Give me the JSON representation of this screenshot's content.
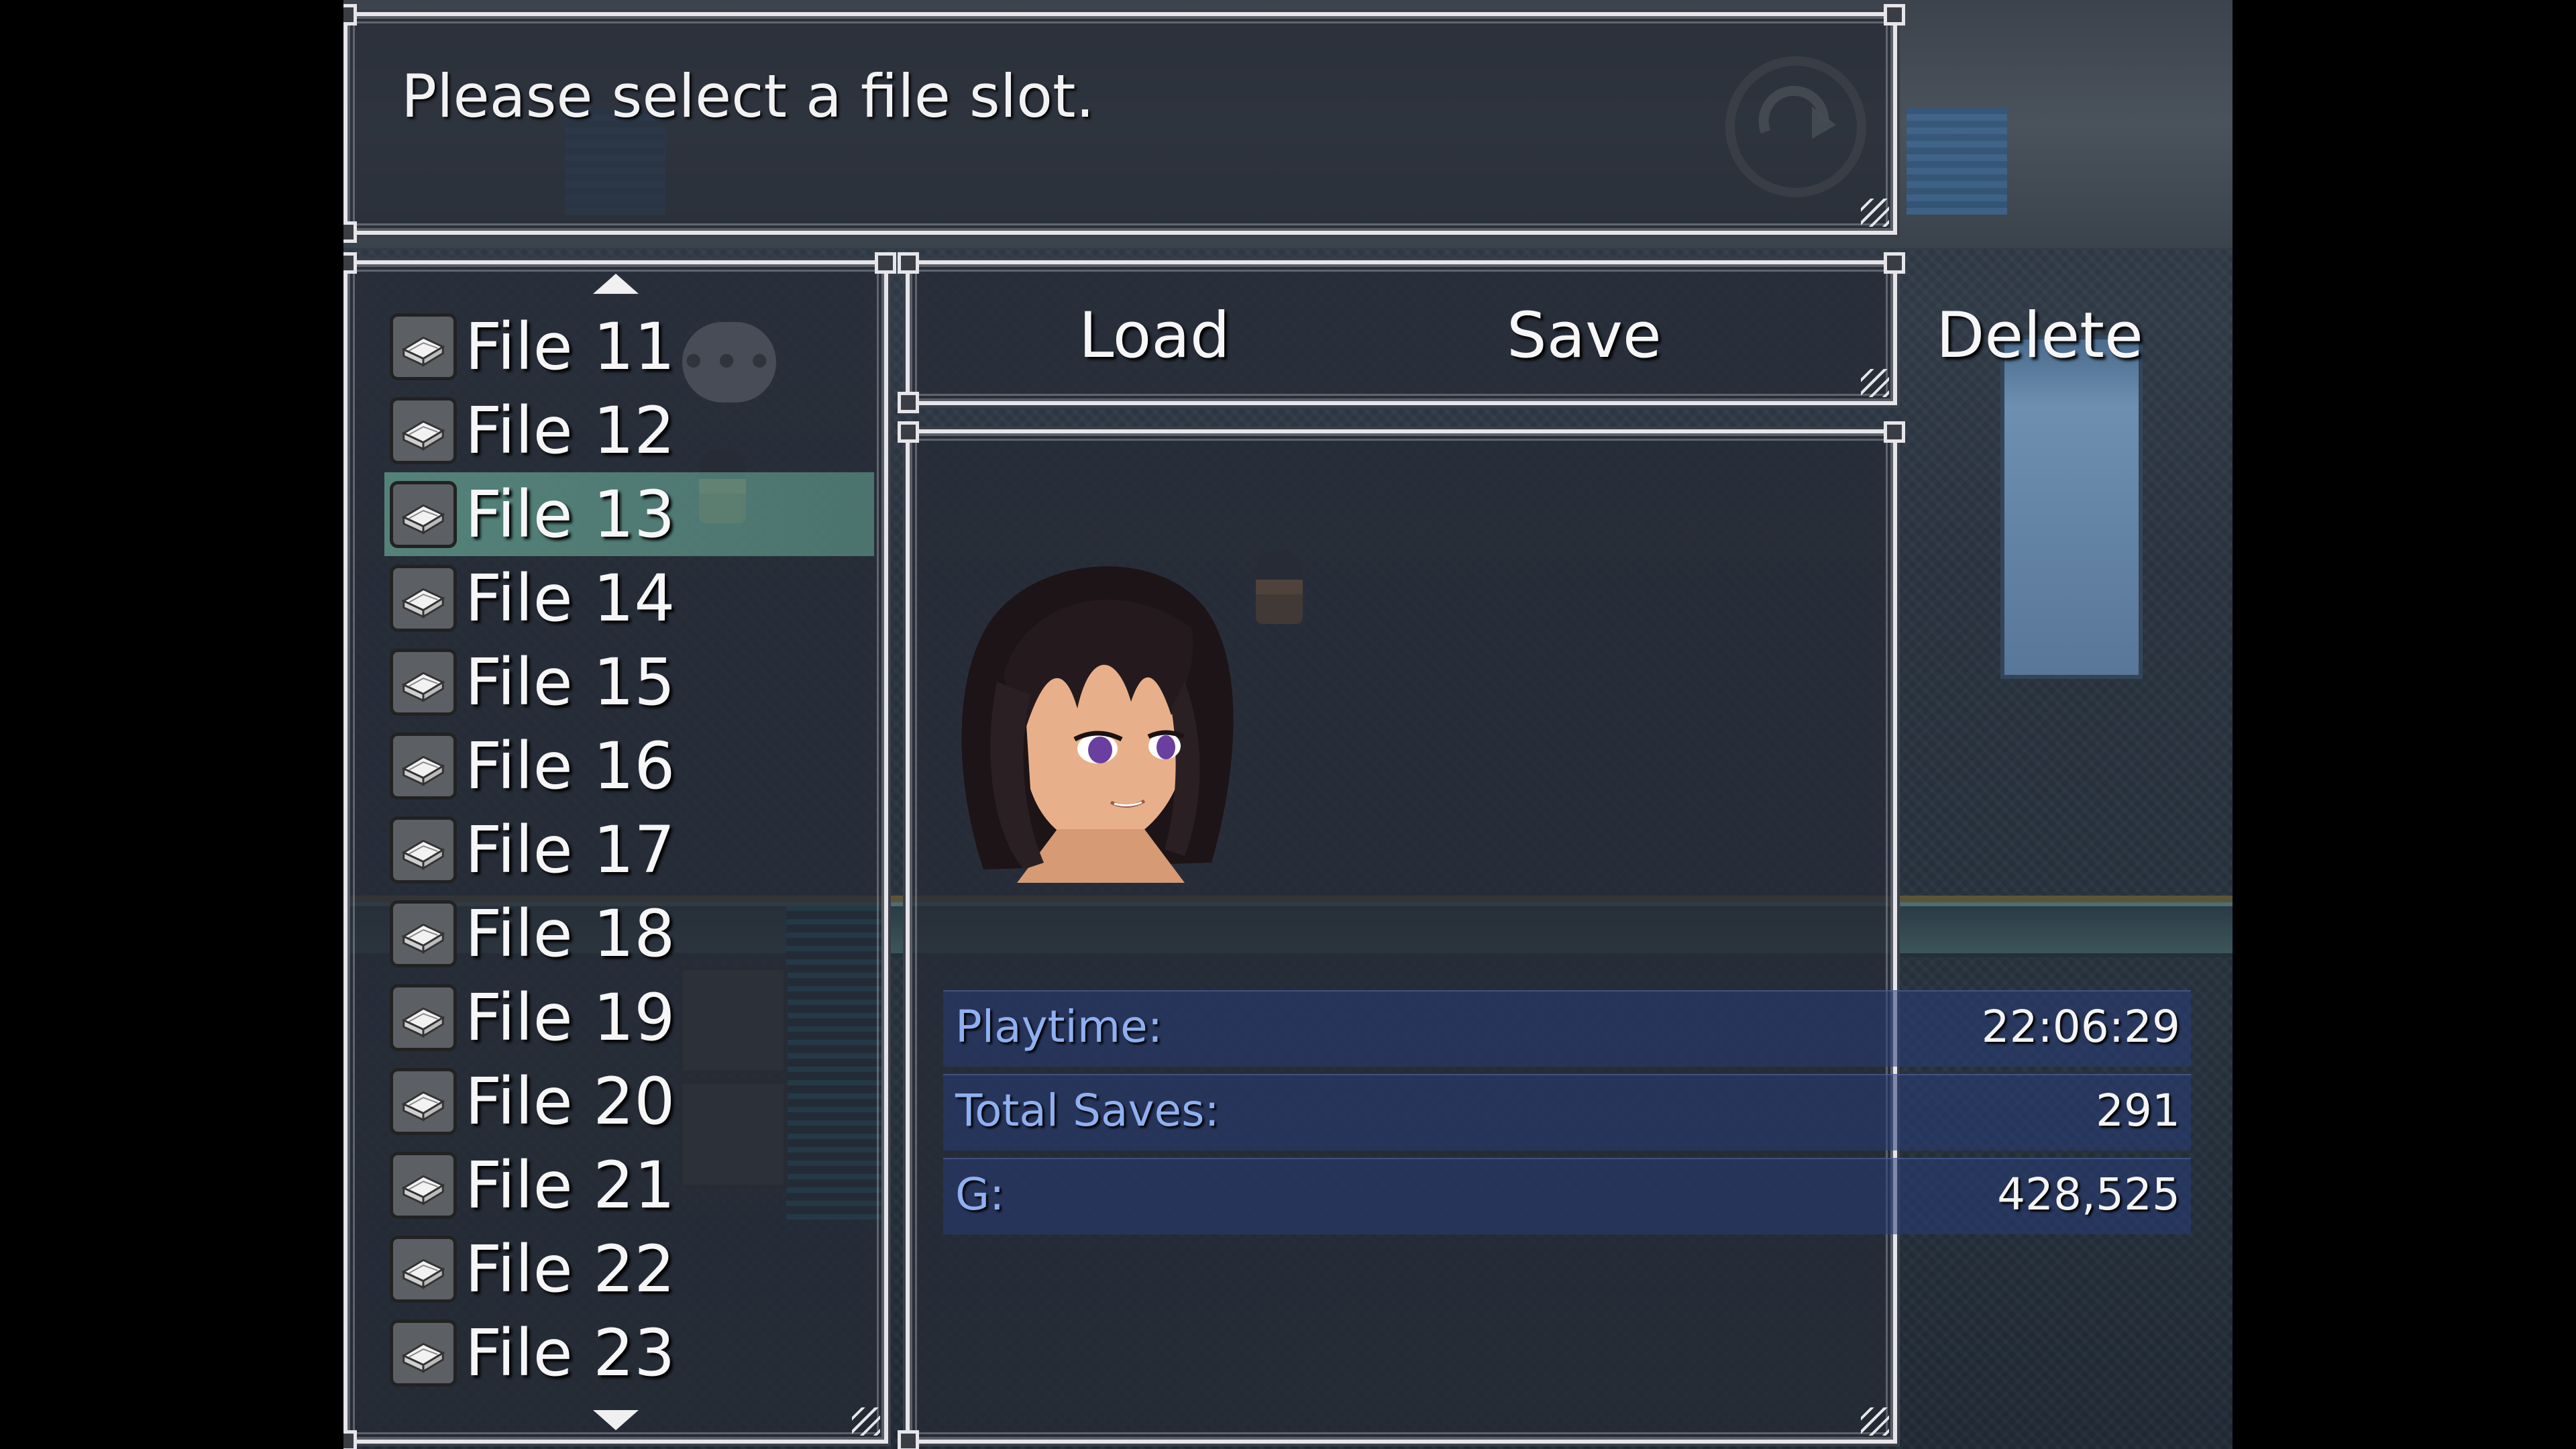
{
  "help": {
    "text": "Please select a file slot."
  },
  "file_list": {
    "items": [
      {
        "label": "File 11"
      },
      {
        "label": "File 12"
      },
      {
        "label": "File 13",
        "selected": true
      },
      {
        "label": "File 14"
      },
      {
        "label": "File 15"
      },
      {
        "label": "File 16"
      },
      {
        "label": "File 17"
      },
      {
        "label": "File 18"
      },
      {
        "label": "File 19"
      },
      {
        "label": "File 20"
      },
      {
        "label": "File 21"
      },
      {
        "label": "File 22"
      },
      {
        "label": "File 23"
      }
    ],
    "icon": "book-icon"
  },
  "commands": {
    "load": "Load",
    "save": "Save",
    "delete": "Delete"
  },
  "save_info": {
    "playtime_label": "Playtime:",
    "playtime_value": "22:06:29",
    "total_saves_label": "Total Saves:",
    "total_saves_value": "291",
    "gold_label": "G:",
    "gold_value": "428,525"
  },
  "colors": {
    "selection": "#78c8af",
    "stat_label": "#8fb0f0",
    "window_border": "#e6e6ea"
  }
}
